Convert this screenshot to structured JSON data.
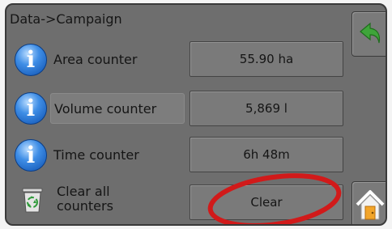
{
  "screen": {
    "title": "Data->Campaign"
  },
  "rows": [
    {
      "label": "Area counter",
      "value": "55.90 ha",
      "icon": "info-icon"
    },
    {
      "label": "Volume counter",
      "value": "5,869 l",
      "icon": "info-icon"
    },
    {
      "label": "Time counter",
      "value": "6h 48m",
      "icon": "info-icon"
    }
  ],
  "clear_row": {
    "label_line1": "Clear all",
    "label_line2": "counters",
    "button_label": "Clear",
    "icon": "recycle-bin-icon"
  },
  "nav": {
    "back_icon": "back-arrow-icon",
    "home_icon": "home-icon"
  },
  "info_glyph": "i",
  "colors": {
    "panel": "#6e6e6e",
    "button": "#7a7a7a",
    "info_blue": "#2a72d6",
    "back_green": "#3fa53a",
    "highlight_red": "#d11a1a",
    "home_orange": "#f2a52a"
  }
}
